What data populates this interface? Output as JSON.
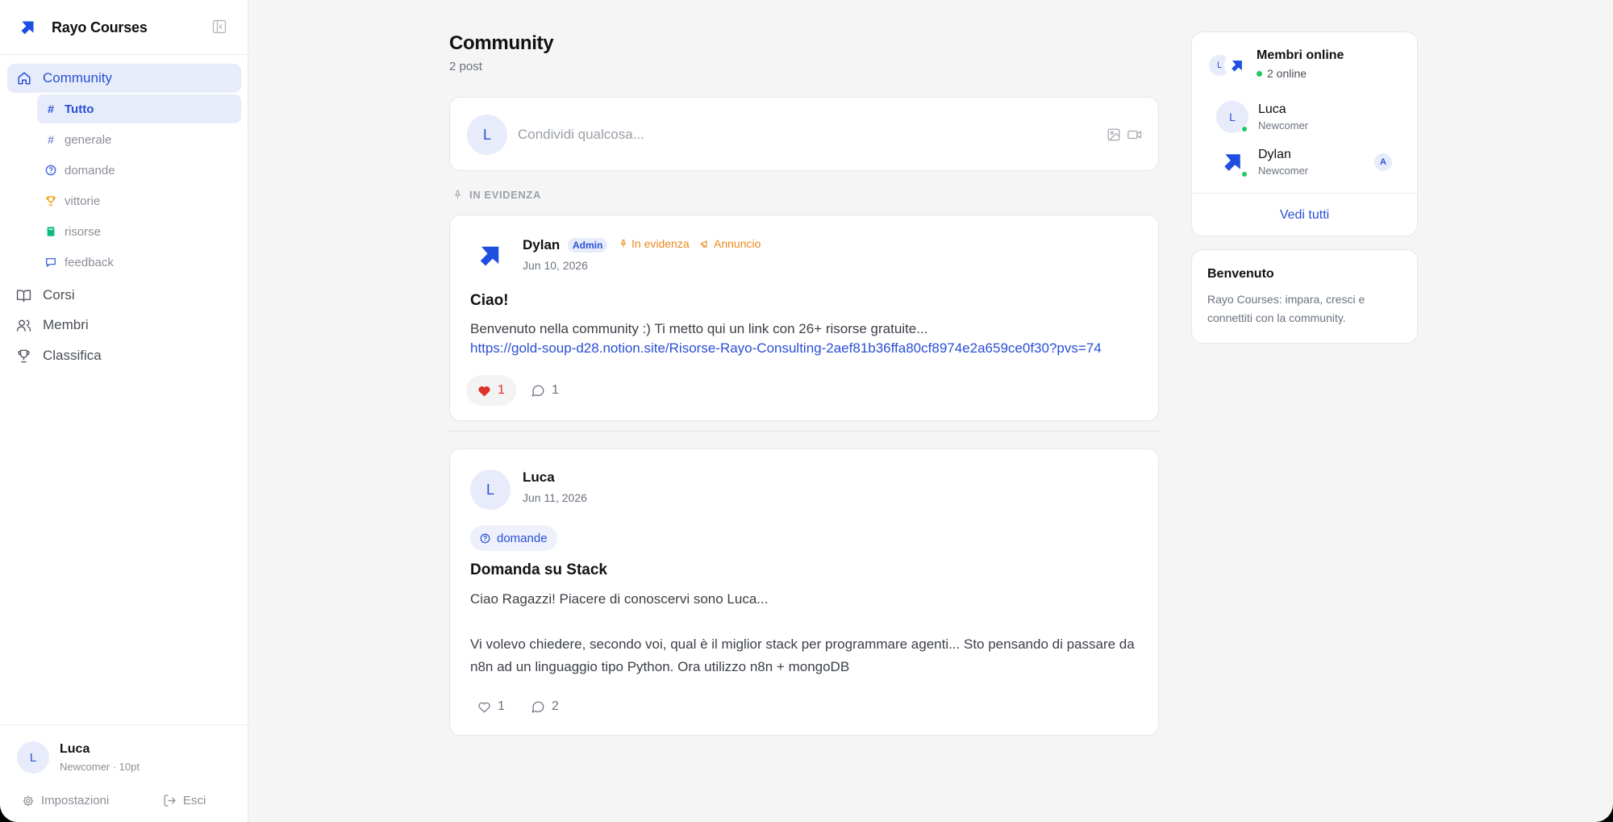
{
  "brand": {
    "name": "Rayo Courses"
  },
  "sidebar": {
    "community_label": "Community",
    "channels": [
      {
        "label": "Tutto",
        "icon": "hash-icon"
      },
      {
        "label": "generale",
        "icon": "hash-icon"
      },
      {
        "label": "domande",
        "icon": "question-circle-icon"
      },
      {
        "label": "vittorie",
        "icon": "trophy-icon"
      },
      {
        "label": "risorse",
        "icon": "book-icon"
      },
      {
        "label": "feedback",
        "icon": "message-square-icon"
      }
    ],
    "main_items": [
      {
        "label": "Corsi",
        "icon": "book-open-icon"
      },
      {
        "label": "Membri",
        "icon": "users-icon"
      },
      {
        "label": "Classifica",
        "icon": "trophy-icon"
      }
    ],
    "user": {
      "initial": "L",
      "name": "Luca",
      "meta": "Newcomer · 10pt"
    },
    "footer": {
      "settings_label": "Impostazioni",
      "logout_label": "Esci"
    }
  },
  "main": {
    "title": "Community",
    "post_count": "2 post",
    "composer": {
      "initial": "L",
      "placeholder": "Condividi qualcosa..."
    },
    "pinned_label": "IN EVIDENZA",
    "posts": [
      {
        "author": "Dylan",
        "badge": "Admin",
        "pinned_tag": "In evidenza",
        "announce_tag": "Annuncio",
        "date": "Jun 10, 2026",
        "title": "Ciao!",
        "body": "Benvenuto nella community :) Ti metto qui un link con 26+ risorse gratuite...",
        "link": "https://gold-soup-d28.notion.site/Risorse-Rayo-Consulting-2aef81b36ffa80cf8974e2a659ce0f30?pvs=74",
        "likes": "1",
        "comments": "1"
      },
      {
        "author": "Luca",
        "initial": "L",
        "date": "Jun 11, 2026",
        "tag": "domande",
        "title": "Domanda su Stack",
        "body_line1": "Ciao Ragazzi! Piacere di conoscervi sono Luca...",
        "body_line2": "Vi volevo chiedere, secondo voi, qual è il miglior stack per programmare agenti... Sto pensando di passare da n8n ad un linguaggio tipo Python. Ora utilizzo n8n + mongoDB",
        "likes": "1",
        "comments": "2"
      }
    ]
  },
  "right": {
    "online": {
      "title": "Membri online",
      "count": "2 online",
      "avatar_initial": "L",
      "members": [
        {
          "initial": "L",
          "name": "Luca",
          "role": "Newcomer"
        },
        {
          "name": "Dylan",
          "role": "Newcomer",
          "badge": "A"
        }
      ],
      "see_all": "Vedi tutti"
    },
    "welcome": {
      "title": "Benvenuto",
      "text": "Rayo Courses: impara, cresci e connettiti con la community."
    }
  },
  "colors": {
    "accent": "#2a4fd6",
    "orange": "#ea8a1a",
    "online": "#22c55e",
    "like": "#e0322b"
  }
}
